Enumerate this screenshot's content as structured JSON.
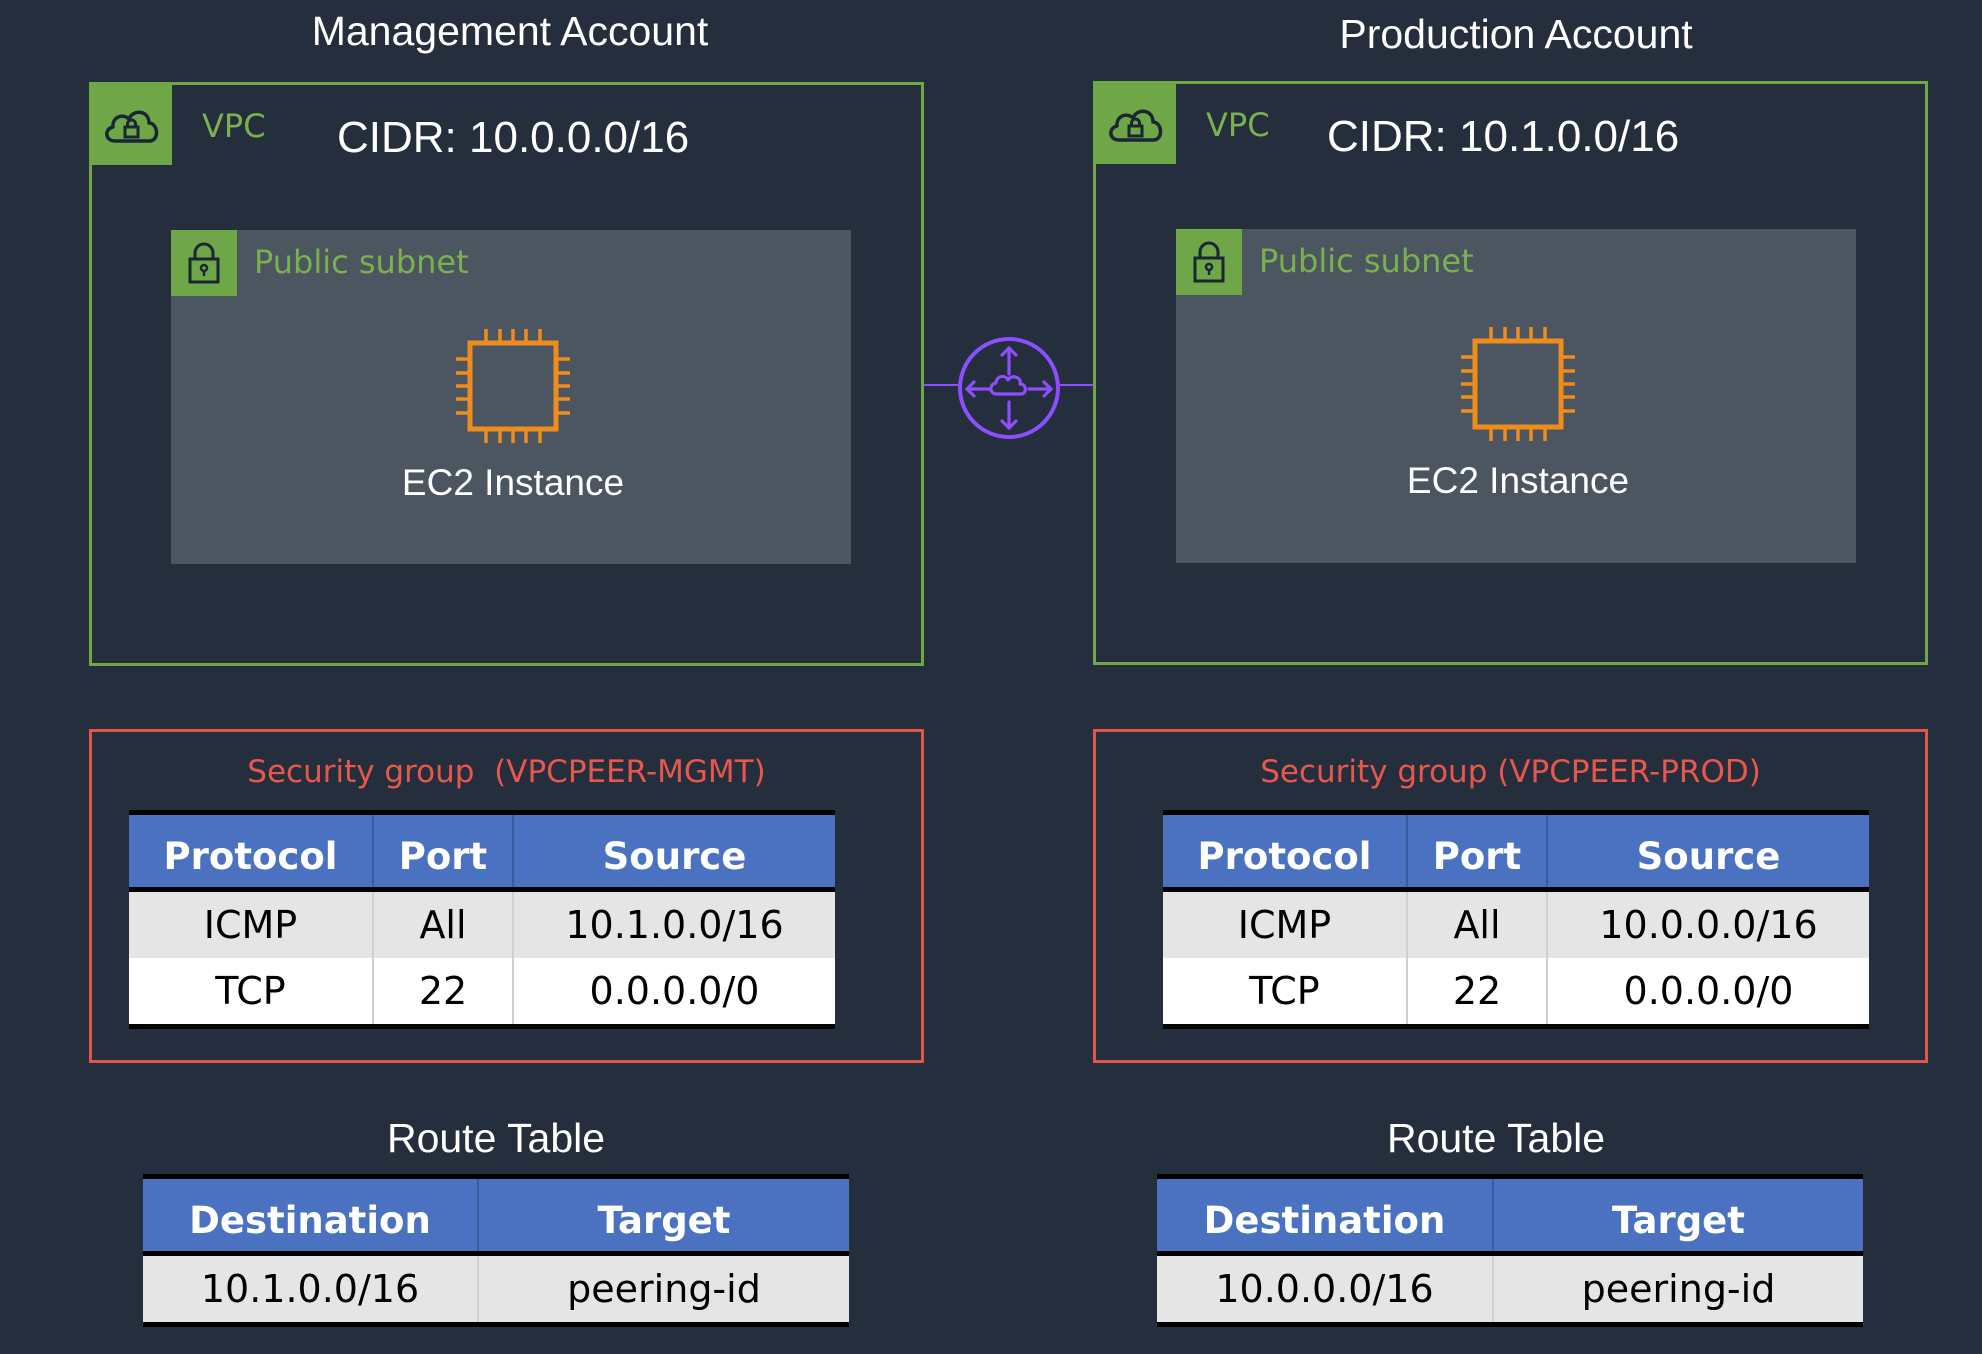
{
  "accounts": [
    {
      "title": "Management Account",
      "vpc_label": "VPC",
      "cidr": "CIDR: 10.0.0.0/16",
      "subnet_label": "Public subnet",
      "instance_label": "EC2 Instance",
      "security_group": {
        "title": "Security group  (VPCPEER-MGMT)",
        "headers": [
          "Protocol",
          "Port",
          "Source"
        ],
        "rows": [
          [
            "ICMP",
            "All",
            "10.1.0.0/16"
          ],
          [
            "TCP",
            "22",
            "0.0.0.0/0"
          ]
        ]
      },
      "route_table": {
        "title": "Route Table",
        "headers": [
          "Destination",
          "Target"
        ],
        "rows": [
          [
            "10.1.0.0/16",
            "peering-id"
          ]
        ]
      }
    },
    {
      "title": "Production Account",
      "vpc_label": "VPC",
      "cidr": "CIDR: 10.1.0.0/16",
      "subnet_label": "Public subnet",
      "instance_label": "EC2 Instance",
      "security_group": {
        "title": "Security group (VPCPEER-PROD)",
        "headers": [
          "Protocol",
          "Port",
          "Source"
        ],
        "rows": [
          [
            "ICMP",
            "All",
            "10.0.0.0/16"
          ],
          [
            "TCP",
            "22",
            "0.0.0.0/0"
          ]
        ]
      },
      "route_table": {
        "title": "Route Table",
        "headers": [
          "Destination",
          "Target"
        ],
        "rows": [
          [
            "10.0.0.0/16",
            "peering-id"
          ]
        ]
      }
    }
  ],
  "icons": {
    "vpc": "vpc-cloud-lock-icon",
    "subnet": "padlock-icon",
    "instance": "ec2-chip-icon",
    "peering": "vpc-peering-icon"
  },
  "colors": {
    "background": "#242e3c",
    "vpc_green": "#6ea648",
    "subnet_fill": "#4b5660",
    "security_red": "#e2574c",
    "table_header_blue": "#4a72c0",
    "ec2_orange": "#ef8d1c",
    "peering_purple": "#8c4fff"
  }
}
